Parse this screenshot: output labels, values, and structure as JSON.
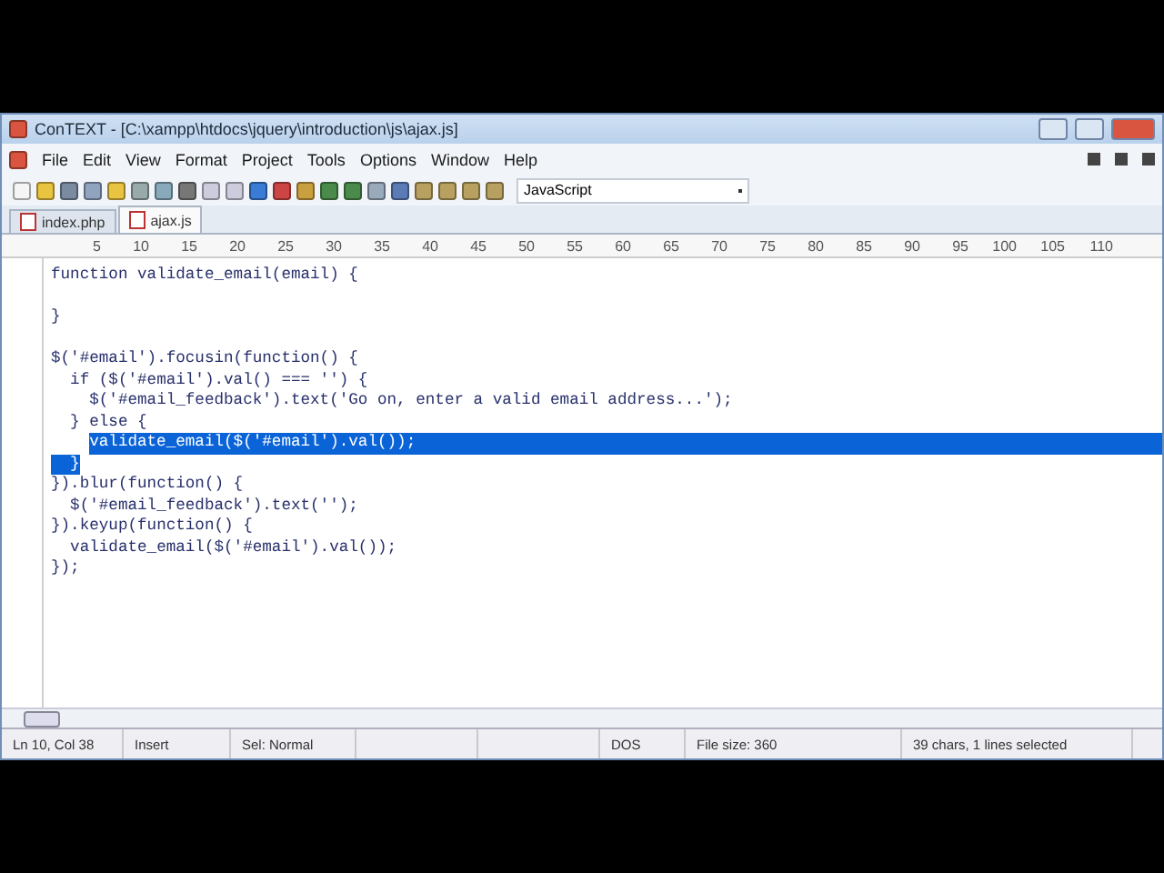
{
  "window": {
    "title": "ConTEXT - [C:\\xampp\\htdocs\\jquery\\introduction\\js\\ajax.js]"
  },
  "menu": [
    "File",
    "Edit",
    "View",
    "Format",
    "Project",
    "Tools",
    "Options",
    "Window",
    "Help"
  ],
  "toolbar": {
    "language": "JavaScript"
  },
  "tabs": [
    {
      "label": "index.php",
      "selected": false
    },
    {
      "label": "ajax.js",
      "selected": true
    }
  ],
  "ruler": [
    "5",
    "10",
    "15",
    "20",
    "25",
    "30",
    "35",
    "40",
    "45",
    "50",
    "55",
    "60",
    "65",
    "70",
    "75",
    "80",
    "85",
    "90",
    "95",
    "100",
    "105",
    "110"
  ],
  "lines": [
    {
      "segments": [
        {
          "text": "function validate_email(email) {",
          "selected": false
        }
      ]
    },
    {
      "kind": "blank"
    },
    {
      "segments": [
        {
          "text": "}",
          "selected": false
        }
      ]
    },
    {
      "kind": "blank"
    },
    {
      "segments": [
        {
          "text": "$('#email').focusin(function() {",
          "selected": false
        }
      ]
    },
    {
      "segments": [
        {
          "text": "  if ($('#email').val() === '') {",
          "selected": false
        }
      ]
    },
    {
      "segments": [
        {
          "text": "    $('#email_feedback').text('Go on, enter a valid email address...');",
          "selected": false
        }
      ]
    },
    {
      "segments": [
        {
          "text": "  } else {",
          "selected": false
        }
      ]
    },
    {
      "kind": "indented",
      "segments": [
        {
          "text": "validate_email($('#email').val());",
          "selected": true
        }
      ],
      "eol_selected": true
    },
    {
      "segments": [
        {
          "text": "  }",
          "selected": true
        }
      ]
    },
    {
      "segments": [
        {
          "text": "}).blur(function() {",
          "selected": false
        }
      ]
    },
    {
      "segments": [
        {
          "text": "  $('#email_feedback').text('');",
          "selected": false
        }
      ]
    },
    {
      "segments": [
        {
          "text": "}).keyup(function() {",
          "selected": false
        }
      ]
    },
    {
      "segments": [
        {
          "text": "  validate_email($('#email').val());",
          "selected": false
        }
      ]
    },
    {
      "segments": [
        {
          "text": "});",
          "selected": false
        }
      ]
    }
  ],
  "status_bar": [
    "Ln 10, Col 38",
    "Insert",
    "Sel: Normal",
    "DOS",
    "File size: 360",
    "39 chars, 1 lines selected"
  ]
}
